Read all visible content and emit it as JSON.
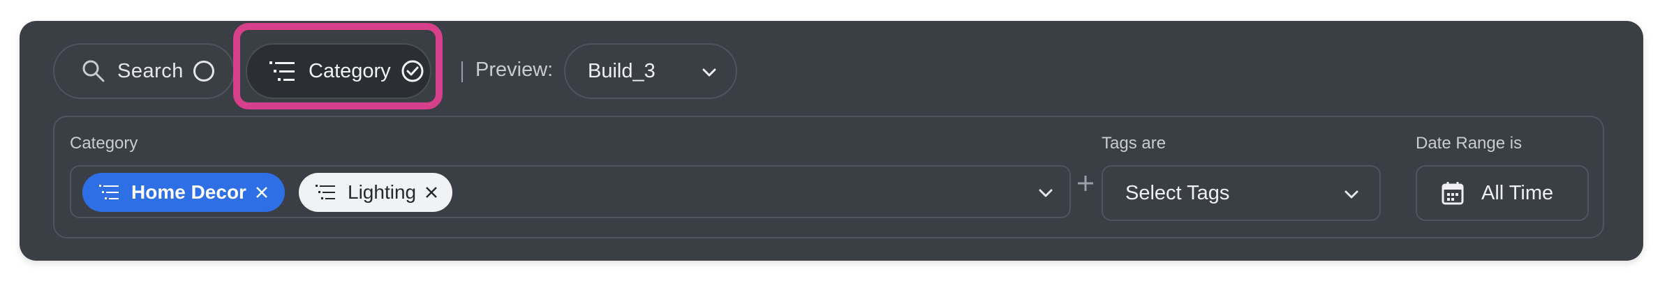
{
  "toolbar": {
    "search_label": "Search",
    "category_label": "Category",
    "preview_label": "Preview:",
    "preview_value": "Build_3"
  },
  "filters": {
    "category_label": "Category",
    "chips": [
      {
        "label": "Home Decor",
        "style": "selected"
      },
      {
        "label": "Lighting",
        "style": "default"
      }
    ],
    "tags_label": "Tags are",
    "tags_placeholder": "Select Tags",
    "date_label": "Date Range is",
    "date_value": "All Time"
  },
  "colors": {
    "panel_bg": "#3a3e45",
    "accent_blue": "#2f6fe6",
    "highlight": "#d6408a"
  }
}
